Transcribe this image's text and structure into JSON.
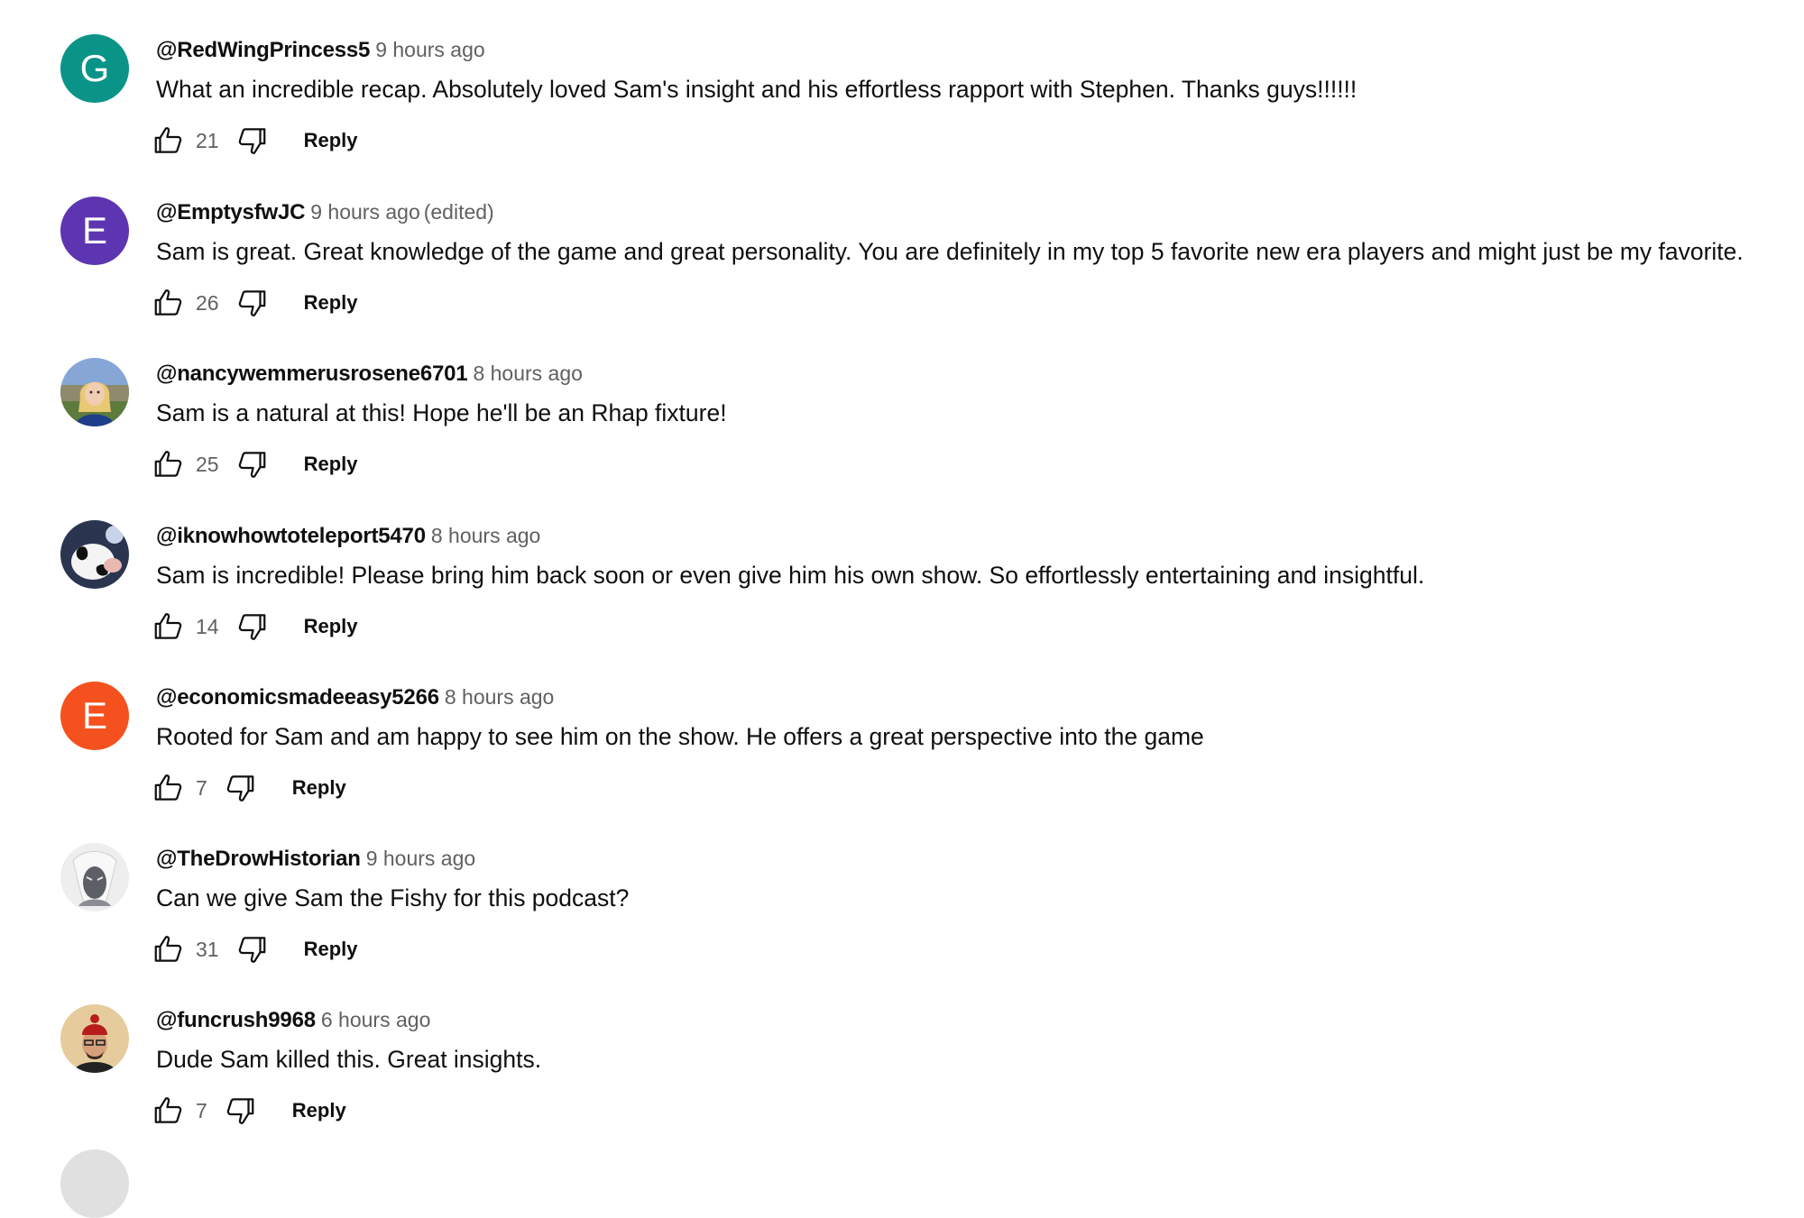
{
  "comments": [
    {
      "author": "@RedWingPrincess5",
      "time": "9 hours ago",
      "edited": "",
      "text": "What an incredible recap. Absolutely loved Sam's insight and his effortless rapport with Stephen. Thanks guys!!!!!!",
      "likes": "21",
      "reply_label": "Reply",
      "avatar_letter": "G",
      "avatar_color": "#0a9488"
    },
    {
      "author": "@EmptysfwJC",
      "time": "9 hours ago",
      "edited": "(edited)",
      "text": "Sam is great. Great knowledge of the game and great personality. You are definitely in my top 5 favorite new era players and might just be my favorite.",
      "likes": "26",
      "reply_label": "Reply",
      "avatar_letter": "E",
      "avatar_color": "#5e35b1"
    },
    {
      "author": "@nancywemmerusrosene6701",
      "time": "8 hours ago",
      "edited": "",
      "text": "Sam is a natural at this! Hope he'll be an Rhap fixture!",
      "likes": "25",
      "reply_label": "Reply",
      "avatar_letter": "",
      "avatar_color": "#7a9cc6"
    },
    {
      "author": "@iknowhowtoteleport5470",
      "time": "8 hours ago",
      "edited": "",
      "text": "Sam is incredible! Please bring him back soon or even give him his own show. So effortlessly entertaining and insightful.",
      "likes": "14",
      "reply_label": "Reply",
      "avatar_letter": "",
      "avatar_color": "#3a4a6b"
    },
    {
      "author": "@economicsmadeeasy5266",
      "time": "8 hours ago",
      "edited": "",
      "text": "Rooted for Sam and am happy to see him on the show. He offers a great perspective into the game",
      "likes": "7",
      "reply_label": "Reply",
      "avatar_letter": "E",
      "avatar_color": "#f4511e"
    },
    {
      "author": "@TheDrowHistorian",
      "time": "9 hours ago",
      "edited": "",
      "text": "Can we give Sam the Fishy for this podcast?",
      "likes": "31",
      "reply_label": "Reply",
      "avatar_letter": "",
      "avatar_color": "#d9d9d9"
    },
    {
      "author": "@funcrush9968",
      "time": "6 hours ago",
      "edited": "",
      "text": "Dude Sam killed this. Great insights.",
      "likes": "7",
      "reply_label": "Reply",
      "avatar_letter": "",
      "avatar_color": "#e3c79a"
    }
  ],
  "icons": {
    "like": "thumbs-up-icon",
    "dislike": "thumbs-down-icon"
  }
}
